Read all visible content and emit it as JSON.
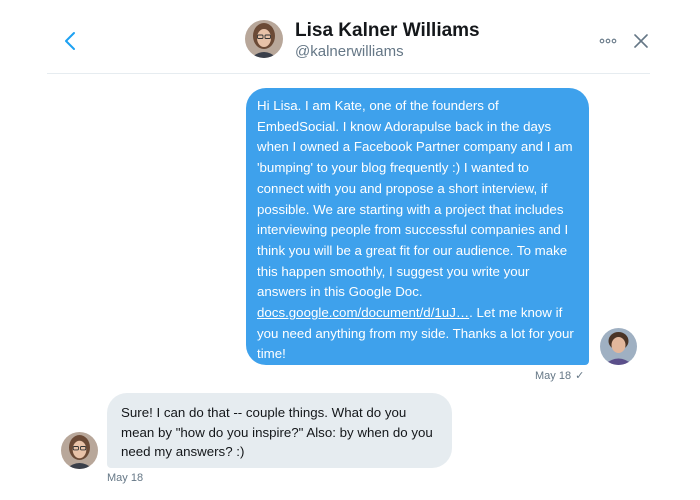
{
  "header": {
    "back_icon": "chevron-left-icon",
    "name": "Lisa Kalner Williams",
    "handle": "@kalnerwilliams",
    "more_icon": "more-horizontal-icon",
    "close_icon": "close-icon"
  },
  "messages": {
    "sent": {
      "text_before_link": "Hi Lisa. I am Kate, one of the founders of EmbedSocial. I know Adorapulse back in the days when I owned a Facebook Partner company and I am 'bumping' to your blog frequently :) I wanted to connect with you and propose a short interview, if possible. We are starting with a project that includes interviewing people from successful companies and I think you will be a great fit for our audience. To make this happen smoothly, I suggest you write your answers in this Google Doc. ",
      "link": "docs.google.com/document/d/1uJ…",
      "text_after_link": ". Let me know if you need anything from my side. Thanks a lot for your time!",
      "date": "May 18",
      "status_icon": "checkmark-icon",
      "status_glyph": "✓"
    },
    "received": {
      "text": "Sure! I can do that -- couple things. What do you mean by \"how do you inspire?\" Also: by when do you need my answers? :)",
      "date": "May 18"
    }
  },
  "colors": {
    "sent_bubble": "#3ea1ec",
    "received_bubble": "#e6ecf0",
    "meta_text": "#657786",
    "icon_blue": "#1da1f2"
  }
}
